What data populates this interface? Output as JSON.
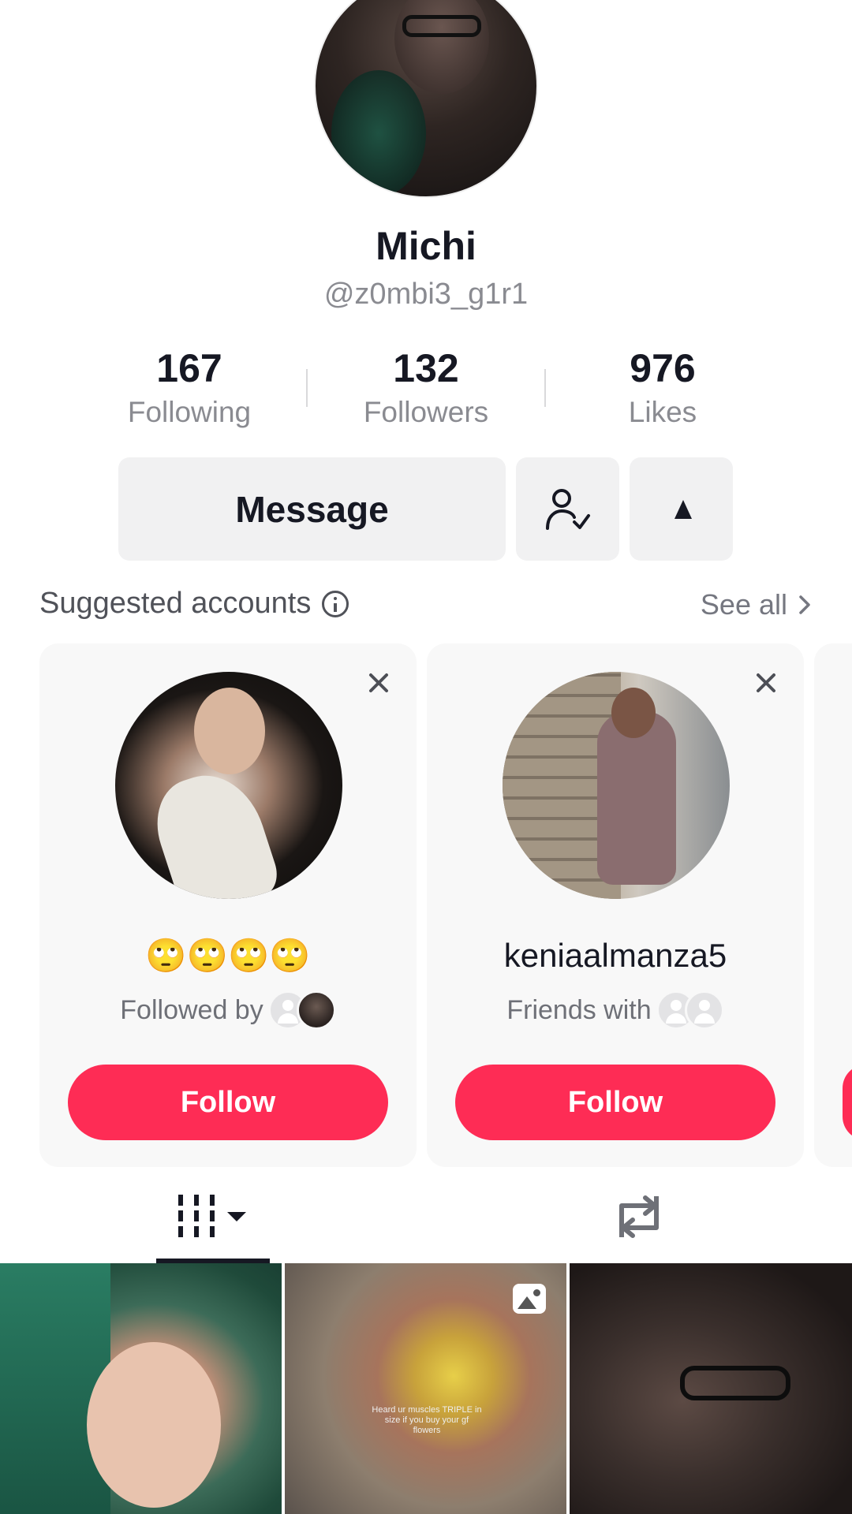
{
  "profile": {
    "name": "Michi",
    "handle": "@z0mbi3_g1r1"
  },
  "stats": [
    {
      "value": "167",
      "label": "Following"
    },
    {
      "value": "132",
      "label": "Followers"
    },
    {
      "value": "976",
      "label": "Likes"
    }
  ],
  "actions": {
    "message_label": "Message",
    "friends_icon": "user-check-icon",
    "more_icon": "triangle-up-icon"
  },
  "suggested": {
    "title": "Suggested accounts",
    "see_all": "See all",
    "cards": [
      {
        "name": "🙄🙄🙄🙄",
        "subtitle": "Followed by",
        "follow_label": "Follow"
      },
      {
        "name": "keniaalmanza5",
        "subtitle": "Friends with",
        "follow_label": "Follow"
      }
    ]
  },
  "tabs": {
    "videos_icon": "grid-icon",
    "reposts_icon": "repost-icon"
  },
  "posts": [
    {
      "overlay_text": ""
    },
    {
      "overlay_text": "Heard ur muscles TRIPLE in size if you buy your gf flowers"
    },
    {
      "overlay_text": ""
    }
  ],
  "colors": {
    "accent": "#fe2c55",
    "text": "#161823",
    "muted": "#8a8b91"
  }
}
